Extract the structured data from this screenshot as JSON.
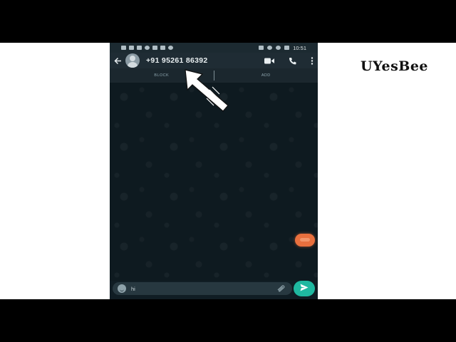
{
  "watermark": {
    "text": "UYesBee"
  },
  "status_bar": {
    "time": "10:51"
  },
  "app_bar": {
    "back_icon": "arrow-left-icon",
    "avatar_icon": "default-avatar-icon",
    "contact_title": "+91 95261 86392",
    "video_call_icon": "video-camera-icon",
    "voice_call_icon": "phone-icon",
    "menu_icon": "more-vertical-icon"
  },
  "action_strip": {
    "block_label": "BLOCK",
    "add_label": "ADD"
  },
  "composer": {
    "emoji_icon": "emoji-icon",
    "message_value": "hi",
    "attach_icon": "paperclip-icon",
    "send_icon": "send-icon"
  },
  "colors": {
    "app_bar": "#1f2c34",
    "chat_background": "#0e1a20",
    "send_button": "#1fb8a0",
    "floating_badge": "#e9703e"
  }
}
